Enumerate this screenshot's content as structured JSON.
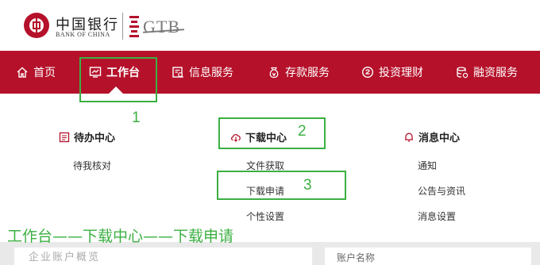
{
  "brand": {
    "bank_name_cn": "中国银行",
    "bank_name_en": "BANK OF CHINA",
    "product_logo": "GTB",
    "primary_color": "#b5112a"
  },
  "nav": {
    "items": [
      {
        "label": "首页",
        "icon": "home-icon"
      },
      {
        "label": "工作台",
        "icon": "workbench-chart-icon",
        "active": true
      },
      {
        "label": "信息服务",
        "icon": "info-service-icon"
      },
      {
        "label": "存款服务",
        "icon": "deposit-icon"
      },
      {
        "label": "投资理财",
        "icon": "investment-icon"
      },
      {
        "label": "融资服务",
        "icon": "financing-icon"
      }
    ]
  },
  "dropdown": {
    "columns": [
      {
        "title": "待办中心",
        "icon": "todo-icon",
        "items": [
          "待我核对"
        ]
      },
      {
        "title": "下载中心",
        "icon": "cloud-download-icon",
        "items": [
          "文件获取",
          "下载申请",
          "个性设置"
        ]
      },
      {
        "title": "消息中心",
        "icon": "bell-icon",
        "items": [
          "通知",
          "公告与资讯",
          "消息设置"
        ]
      }
    ]
  },
  "annotations": {
    "step1": "1",
    "step2": "2",
    "step3": "3",
    "caption": "工作台——下载中心——下载申请",
    "color": "#3cb043"
  },
  "bottom": {
    "left_text": "企业账户概览",
    "right_text": "账户名称"
  }
}
